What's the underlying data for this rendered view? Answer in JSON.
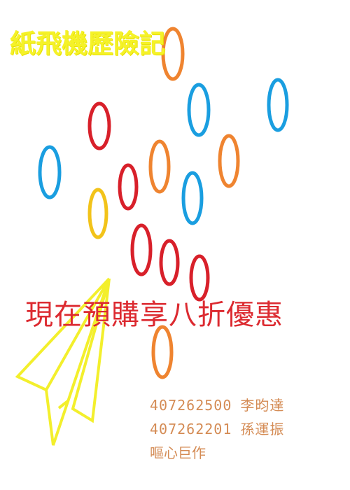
{
  "title": "紙飛機歷險記",
  "promo": "現在預購享八折優惠",
  "credits": [
    {
      "id": "407262500",
      "name": "李昀達"
    },
    {
      "id": "407262201",
      "name": "孫運振"
    }
  ],
  "footer": "嘔心巨作",
  "colors": {
    "background": "#ffffff",
    "title": "#f5f228",
    "promo": "#dc2a30",
    "credits": "#d48b54",
    "ring_red": "#d8202a",
    "ring_blue": "#1a9ee0",
    "ring_orange": "#ef8430",
    "ring_yellow": "#f2c31a",
    "plane": "#f3ef2c"
  },
  "icons": {
    "plane": "paper-plane-icon"
  }
}
